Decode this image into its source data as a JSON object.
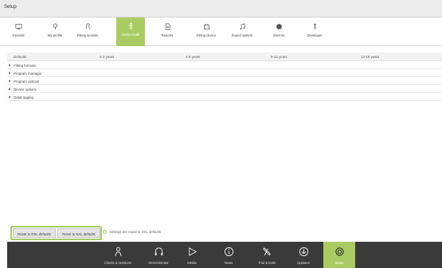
{
  "window": {
    "title": "Setup"
  },
  "toolbar": {
    "items": [
      {
        "label": "General",
        "icon": "monitor-icon"
      },
      {
        "label": "My profile",
        "icon": "profile-icon"
      },
      {
        "label": "Fitting session",
        "icon": "fitting-session-icon"
      },
      {
        "label": "Junior mode",
        "icon": "junior-mode-icon",
        "active": true
      },
      {
        "label": "Reports",
        "icon": "document-icon"
      },
      {
        "label": "Fitting device",
        "icon": "fitting-device-icon"
      },
      {
        "label": "Sound system",
        "icon": "music-note-icon"
      },
      {
        "label": "Internet",
        "icon": "globe-icon"
      },
      {
        "label": "Developer",
        "icon": "developer-icon"
      }
    ]
  },
  "table": {
    "headers": [
      "Defaults",
      "0-3 years",
      "4-8 years",
      "9-12 years",
      "13-18 years"
    ],
    "rows": [
      "Fitting formula",
      "Program manager",
      "Program options",
      "Device options",
      "DataLogging"
    ]
  },
  "actions": {
    "reset_dsl": "Reset to DSL defaults",
    "reset_nal": "Reset to NAL defaults",
    "status": "Settings are equal to DSL defaults"
  },
  "nav": {
    "items": [
      {
        "label": "Clients & sessions",
        "icon": "person-icon"
      },
      {
        "label": "Demonstrator",
        "icon": "headphones-icon"
      },
      {
        "label": "Media",
        "icon": "play-icon"
      },
      {
        "label": "News",
        "icon": "info-icon"
      },
      {
        "label": "Trial & tools",
        "icon": "tools-icon"
      },
      {
        "label": "Updates",
        "icon": "download-icon"
      },
      {
        "label": "Setup",
        "icon": "gear-icon",
        "active": true
      }
    ]
  },
  "colors": {
    "accent": "#a9cc62",
    "nav_background": "#3a3a3a"
  }
}
